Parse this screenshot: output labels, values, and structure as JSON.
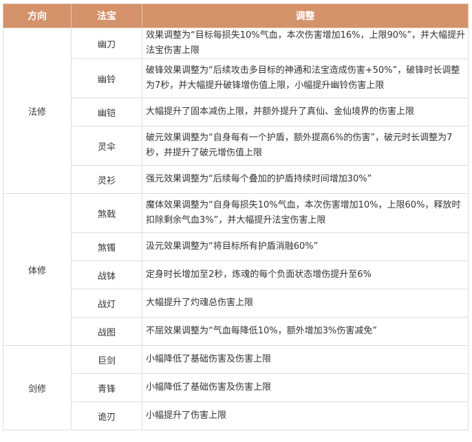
{
  "table": {
    "headers": [
      "方向",
      "法宝",
      "调整"
    ],
    "groups": [
      {
        "direction": "法修",
        "rows": [
          {
            "treasure": "幽刀",
            "adjustment": "效果调整为“目标每损失10%气血，本次伤害增加16%，上限90%”，并大幅提升法宝伤害上限",
            "height": 44
          },
          {
            "treasure": "幽铃",
            "adjustment": "破锋效果调整为“后续攻击多目标的神通和法宝造成伤害+50%”，破锋时长调整为7秒，并大幅提升破锋增伤值上限，小幅提升幽铃伤害上限",
            "height": 57
          },
          {
            "treasure": "幽铠",
            "adjustment": "大幅提升了固本减伤上限，并额外提升了真仙、金仙境界的伤害上限",
            "height": 41
          },
          {
            "treasure": "灵伞",
            "adjustment": "破元效果调整为“自身每有一个护盾，额外提高6%的伤害”，破元时长调整为7秒，并提升了破元增伤值上限",
            "height": 57
          },
          {
            "treasure": "灵衫",
            "adjustment": "强元效果调整为“后续每个叠加的护盾持续时间增加30%”",
            "height": 41
          }
        ]
      },
      {
        "direction": "体修",
        "rows": [
          {
            "treasure": "煞戟",
            "adjustment": "魔体效果调整为“自身每损失10%气血，本次伤害增加10%，上限60%，释放时扣除剩余气血3%”，并大幅提升法宝伤害上限",
            "height": 57
          },
          {
            "treasure": "煞镯",
            "adjustment": "汲元效果调整为“将目标所有护盾消融60%”",
            "height": 41
          },
          {
            "treasure": "战钵",
            "adjustment": "定身时长增加至2秒，炼魂的每个负面状态增伤提升至6%",
            "height": 41
          },
          {
            "treasure": "战灯",
            "adjustment": "大幅提升了灼魂总伤害上限",
            "height": 41
          },
          {
            "treasure": "战图",
            "adjustment": "不屈效果调整为“气血每降低10%，额外增加3%伤害减免”",
            "height": 41
          }
        ]
      },
      {
        "direction": "剑修",
        "rows": [
          {
            "treasure": "巨剑",
            "adjustment": "小幅降低了基础伤害及伤害上限",
            "height": 41
          },
          {
            "treasure": "青锋",
            "adjustment": "小幅降低了基础伤害及伤害上限",
            "height": 41
          },
          {
            "treasure": "诡刃",
            "adjustment": "小幅提升了伤害上限",
            "height": 41
          }
        ]
      }
    ]
  }
}
